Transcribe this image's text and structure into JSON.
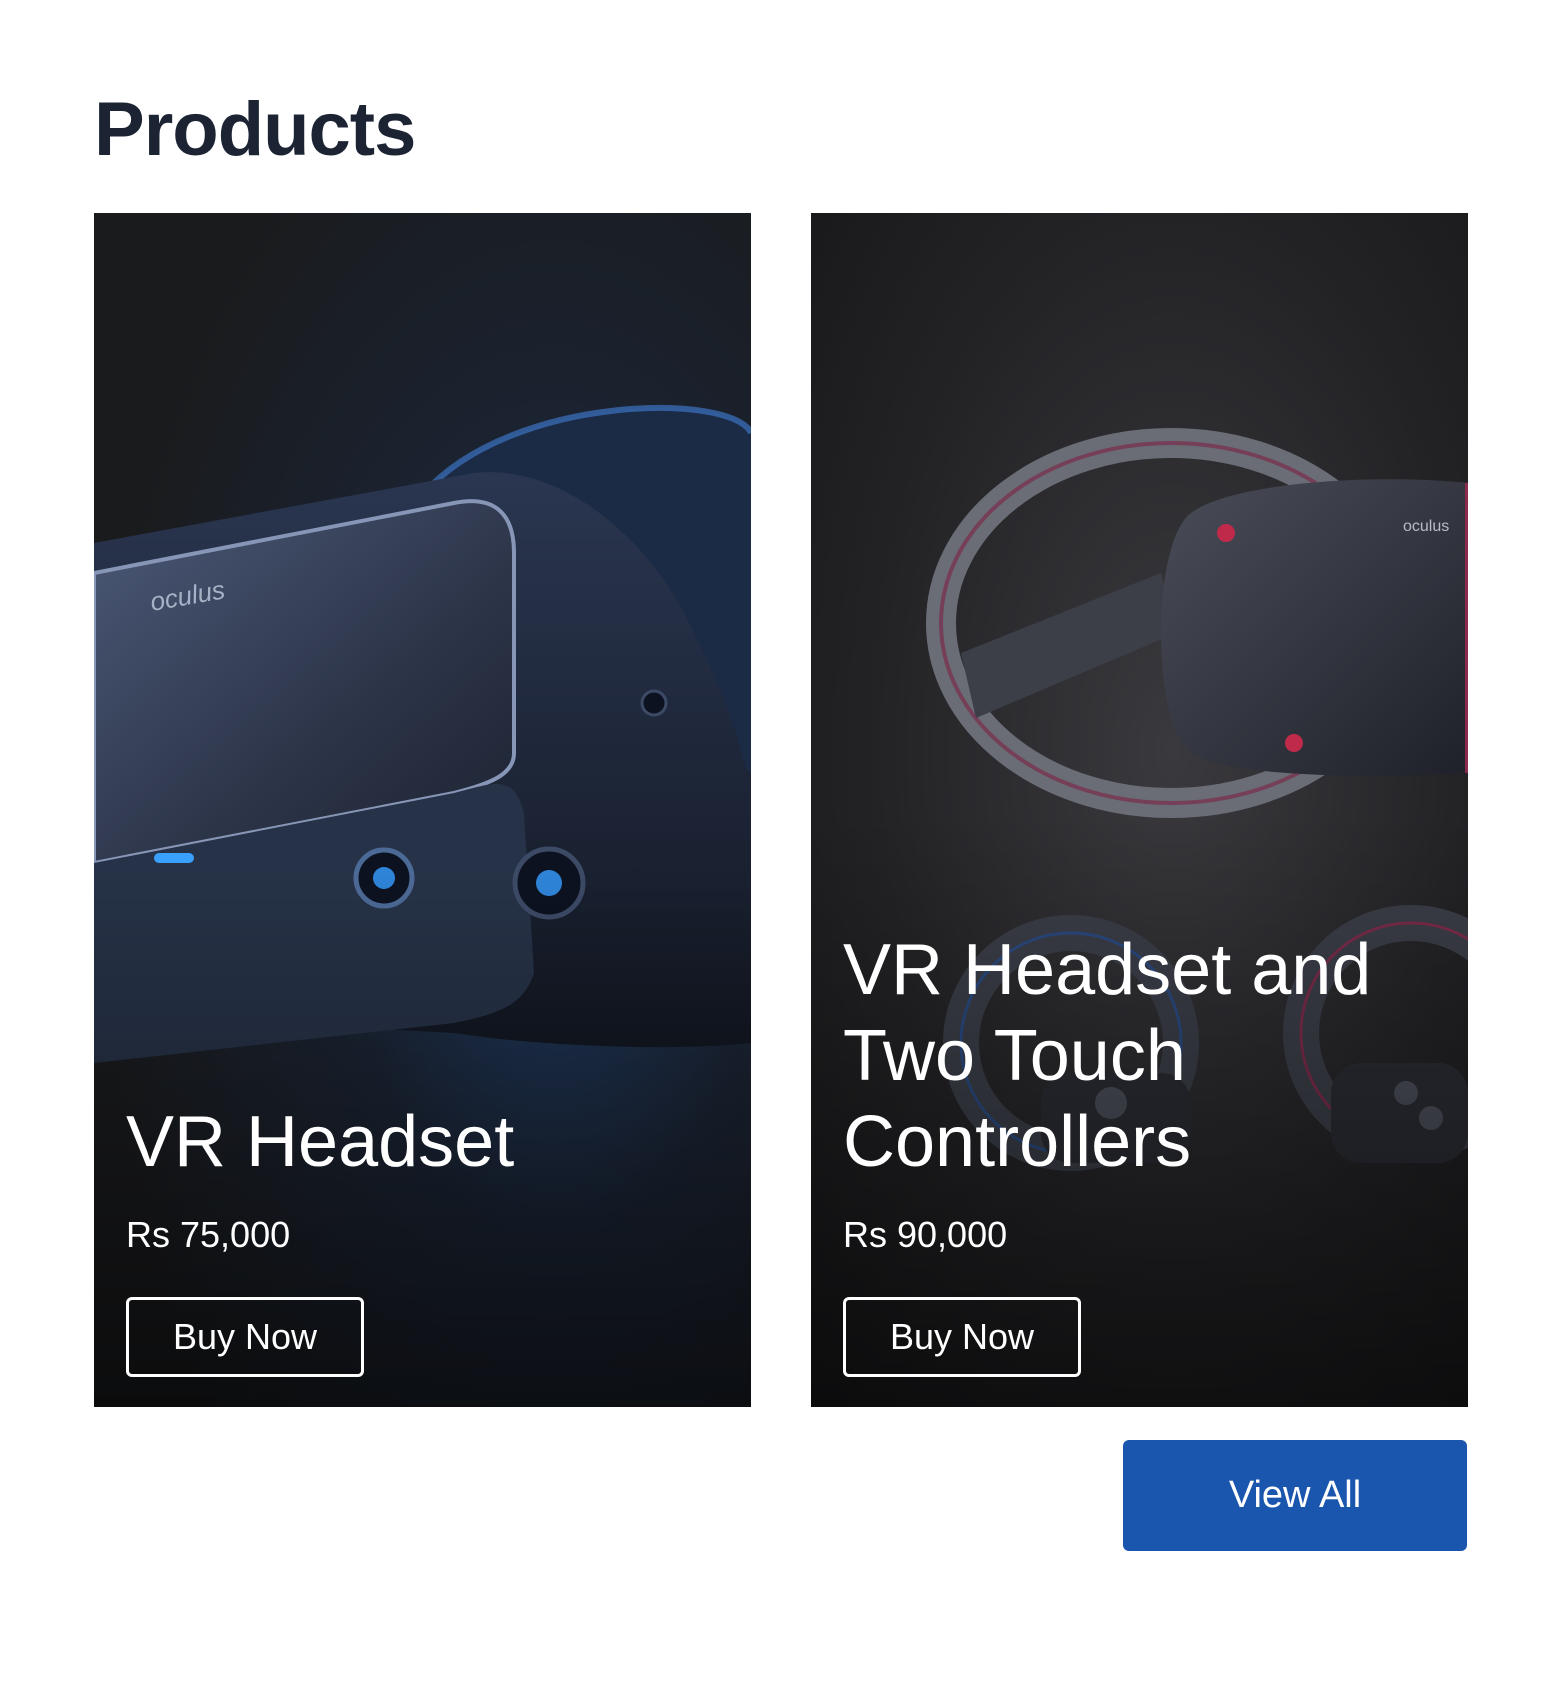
{
  "page": {
    "title": "Products"
  },
  "products": [
    {
      "name": "VR Headset",
      "price": "Rs 75,000",
      "button_label": "Buy Now",
      "image_brand_text": "oculus"
    },
    {
      "name": "VR Headset and Two Touch Controllers",
      "price": "Rs 90,000",
      "button_label": "Buy Now",
      "image_brand_text": "oculus"
    }
  ],
  "footer": {
    "view_all_label": "View All"
  },
  "colors": {
    "title": "#1c2434",
    "card_background": "#1c1d20",
    "accent_blue": "#1a56ad",
    "button_text": "#ffffff"
  }
}
